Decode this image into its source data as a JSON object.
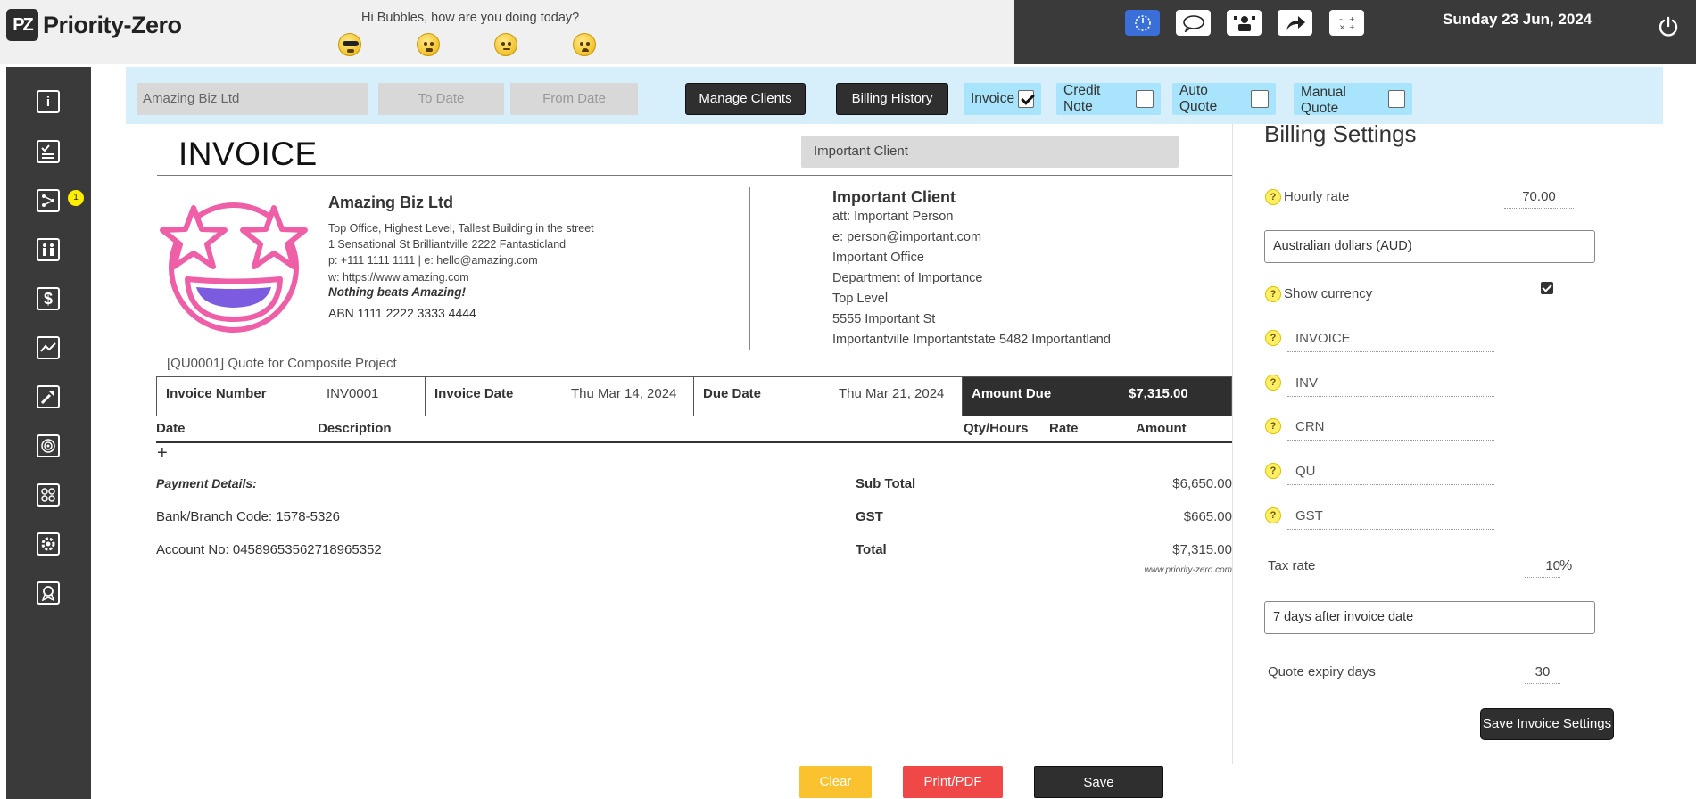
{
  "app": {
    "name": "Priority-Zero",
    "logo_mark": "PZ"
  },
  "header": {
    "greeting": "Hi Bubbles, how are you doing today?",
    "moods": [
      "cool-face-icon",
      "happy-face-icon",
      "neutral-face-icon",
      "sad-face-icon"
    ],
    "toolbar_icons": [
      "timer-icon",
      "chat-bubble-icon",
      "presenter-icon",
      "share-arrow-icon",
      "calculator-icon"
    ],
    "date": "Sunday 23 Jun, 2024"
  },
  "sidebar": {
    "items": [
      "info-icon",
      "checklist-icon",
      "workflow-icon",
      "team-icon",
      "dollar-icon",
      "trend-chart-icon",
      "tools-icon",
      "target-icon",
      "network-icon",
      "settings-gear-icon",
      "award-icon"
    ],
    "badge_count": "1"
  },
  "filters": {
    "business": "Amazing Biz Ltd",
    "to_date_placeholder": "To Date",
    "from_date_placeholder": "From Date",
    "manage_clients": "Manage Clients",
    "billing_history": "Billing History",
    "invoice": "Invoice",
    "credit_note": "Credit Note",
    "auto_quote": "Auto Quote",
    "manual_quote": "Manual Quote"
  },
  "invoice": {
    "title": "INVOICE",
    "client_select": "Important Client",
    "business": {
      "name": "Amazing Biz Ltd",
      "address1": "Top Office, Highest Level, Tallest Building in the street",
      "address2": "1 Sensational St Brilliantville 2222 Fantasticland",
      "contact": "p: +111 1111 1111 | e: hello@amazing.com",
      "web": "w: https://www.amazing.com",
      "tagline": "Nothing beats Amazing!",
      "abn": "ABN 1111 2222 3333 4444"
    },
    "client": {
      "name": "Important Client",
      "att": "att: Important Person",
      "email": "e: person@important.com",
      "office": "Important Office",
      "dept": "Department of Importance",
      "level": "Top Level",
      "street": "5555 Important St",
      "city": "Importantville Importantstate 5482 Importantland"
    },
    "quote_ref": "[QU0001] Quote for Composite Project",
    "number_label": "Invoice Number",
    "number": "INV0001",
    "date_label": "Invoice Date",
    "date": "Thu Mar 14, 2024",
    "due_label": "Due Date",
    "due": "Thu Mar 21, 2024",
    "amount_due_label": "Amount Due",
    "amount_due": "$7,315.00",
    "columns": {
      "date": "Date",
      "description": "Description",
      "qty": "Qty/Hours",
      "rate": "Rate",
      "amount": "Amount"
    },
    "add_row": "+",
    "payment": {
      "title": "Payment Details:",
      "bank": "Bank/Branch Code: 1578-5326",
      "account": "Account No: 04589653562718965352"
    },
    "totals": {
      "subtotal_label": "Sub Total",
      "subtotal": "$6,650.00",
      "gst_label": "GST",
      "gst": "$665.00",
      "total_label": "Total",
      "total": "$7,315.00"
    },
    "footer_url": "www.priority-zero.com"
  },
  "billing_settings": {
    "title": "Billing Settings",
    "hourly_rate_label": "Hourly rate",
    "hourly_rate": "70.00",
    "currency": "Australian dollars (AUD)",
    "show_currency_label": "Show currency",
    "show_currency": true,
    "invoice_title": "INVOICE",
    "invoice_prefix": "INV",
    "credit_prefix": "CRN",
    "quote_prefix": "QU",
    "tax_name": "GST",
    "tax_rate_label": "Tax rate",
    "tax_rate": "10",
    "tax_unit": "%",
    "due_terms": "7 days after invoice date",
    "quote_expiry_label": "Quote expiry days",
    "quote_expiry": "30",
    "save_label": "Save Invoice Settings"
  },
  "actions": {
    "clear": "Clear",
    "print": "Print/PDF",
    "save": "Save"
  },
  "colors": {
    "accent_blue": "#d6effb",
    "dark": "#2f2f2f",
    "clear": "#f9c22e",
    "print": "#f04747"
  }
}
